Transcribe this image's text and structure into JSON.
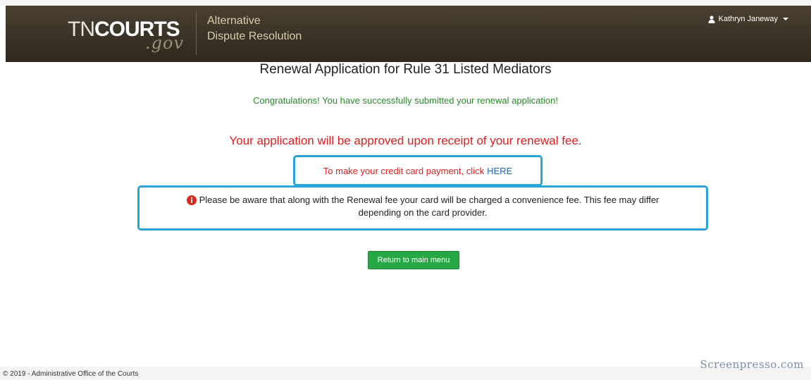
{
  "header": {
    "logo_main_thin": "TN",
    "logo_main_bold": "COURTS",
    "logo_gov": ".gov",
    "brand_line1": "Alternative",
    "brand_line2": "Dispute Resolution",
    "user_name": "Kathryn Janeway"
  },
  "main": {
    "title": "Renewal Application for Rule 31 Listed Mediators",
    "success_message": "Congratulations! You have successfully submitted your renewal application!",
    "approval_message": "Your application will be approved upon receipt of your renewal fee.",
    "payment_prompt": "To make your credit card payment, click",
    "payment_link": "HERE",
    "notice_line1": "Please be aware that along with the Renewal fee your card will be charged a convenience fee. This fee may differ",
    "notice_line2": "depending on the card provider.",
    "return_button": "Return to main menu"
  },
  "footer": {
    "copyright": "© 2019 - Administrative Office of the Courts"
  },
  "watermark": "Screenpresso.com",
  "colors": {
    "success": "#2a8a2a",
    "alert": "#e02020",
    "highlight_border": "#2aa4dc",
    "button": "#28a745",
    "link": "#1f63c9"
  }
}
